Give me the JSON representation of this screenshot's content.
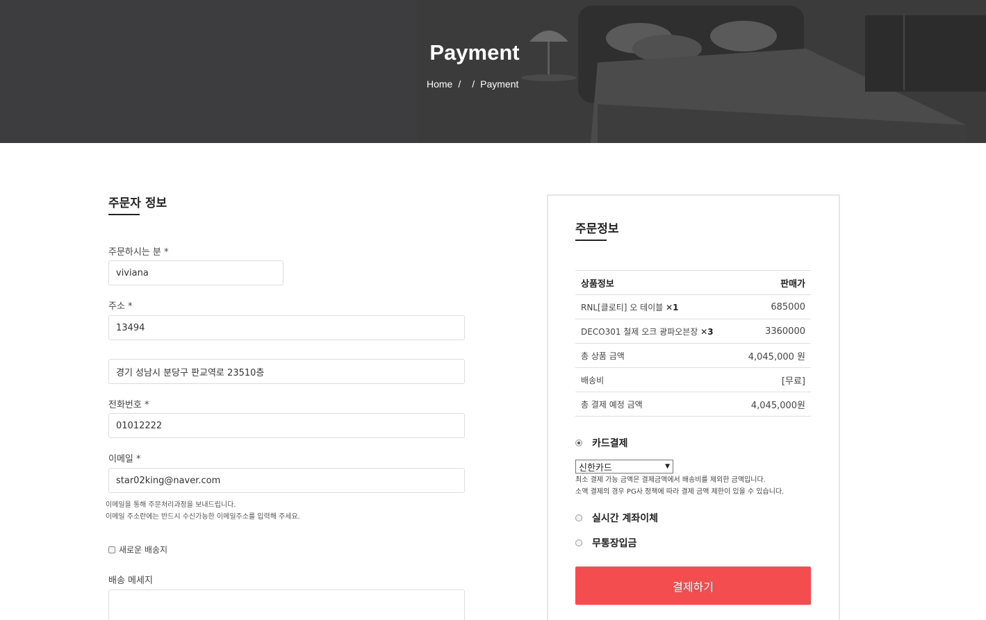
{
  "hero": {
    "title": "Payment",
    "breadcrumb": {
      "home": "Home",
      "current": "Payment"
    }
  },
  "orderer": {
    "title": "주문자 정보",
    "name_label": "주문하시는 분 *",
    "name_value": "viviana",
    "address_label": "주소 *",
    "zipcode_value": "13494",
    "address_value": "경기 성남시 분당구 판교역로 23510층",
    "phone_label": "전화번호 *",
    "phone_value": "01012222",
    "email_label": "이메일 *",
    "email_value": "star02king@naver.com",
    "email_note_1": "이메일을 통해 주문처리과정을 보내드립니다.",
    "email_note_2": "이메일 주소란에는 반드시 수신가능한 이메일주소를 입력해 주세요.",
    "new_address_label": "새로운 배송지",
    "message_label": "배송 메세지",
    "message_value": ""
  },
  "order_info": {
    "title": "주문정보",
    "table_header": {
      "product": "상품정보",
      "price": "판매가"
    },
    "items": [
      {
        "name": "RNL[클로티] 오 테이블",
        "qty": "✕1",
        "price": "685000"
      },
      {
        "name": "DECO301 철제 오크 광파오븐장",
        "qty": "✕3",
        "price": "3360000"
      }
    ],
    "subtotal_label": "총 상품 금액",
    "subtotal_value": "4,045,000 원",
    "shipping_label": "배송비",
    "shipping_value": "[무료]",
    "total_label": "총 결제 예정 금액",
    "total_value": "4,045,000원"
  },
  "payment": {
    "card_label": "카드결제",
    "card_selected": "신한카드",
    "card_note_1": "최소 결제 가능 금액은 결제금액에서 배송비를 제외한 금액입니다.",
    "card_note_2": "소액 결제의 경우 PG사 정책에 따라 결제 금액 제한이 있을 수 있습니다.",
    "transfer_label": "실시간 계좌이체",
    "deposit_label": "무통장입금",
    "submit_label": "결제하기"
  },
  "colors": {
    "hero_bg": "#3a3a3b",
    "accent": "#f44d50"
  }
}
